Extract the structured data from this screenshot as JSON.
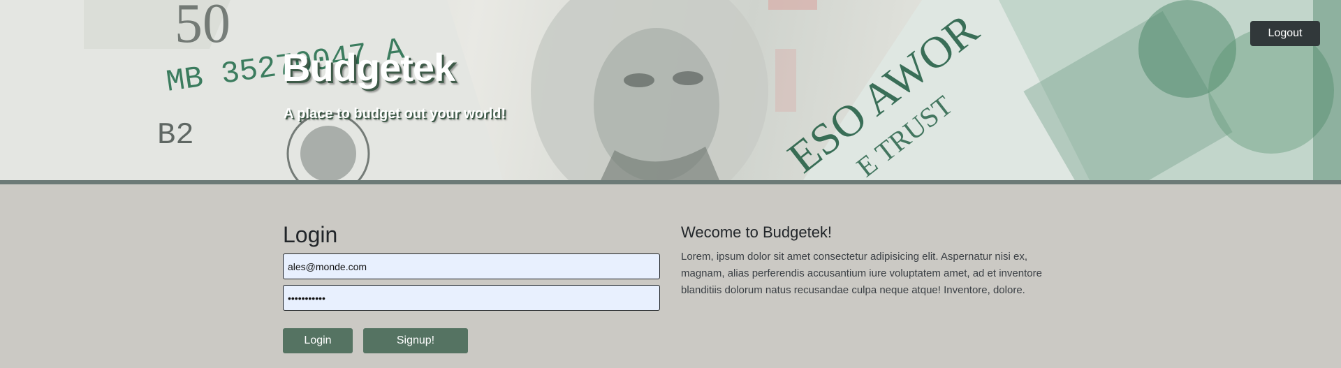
{
  "header": {
    "title": "Budgetek",
    "tagline": "A place to budget out your world!",
    "logout_label": "Logout"
  },
  "login": {
    "heading": "Login",
    "email_value": "ales@monde.com",
    "password_value": "password123",
    "login_label": "Login",
    "signup_label": "Signup!"
  },
  "welcome": {
    "heading": "Wecome to Budgetek!",
    "body": "Lorem, ipsum dolor sit amet consectetur adipisicing elit. Aspernatur nisi ex, magnam, alias perferendis accusantium iure voluptatem amet, ad et inventore blanditiis dolorum natus recusandae culpa neque atque! Inventore, dolore."
  },
  "colors": {
    "accent_green": "#557362",
    "logout_dark": "#31383a",
    "body_bg": "#cbc9c4",
    "input_bg": "#e8f0fe"
  }
}
